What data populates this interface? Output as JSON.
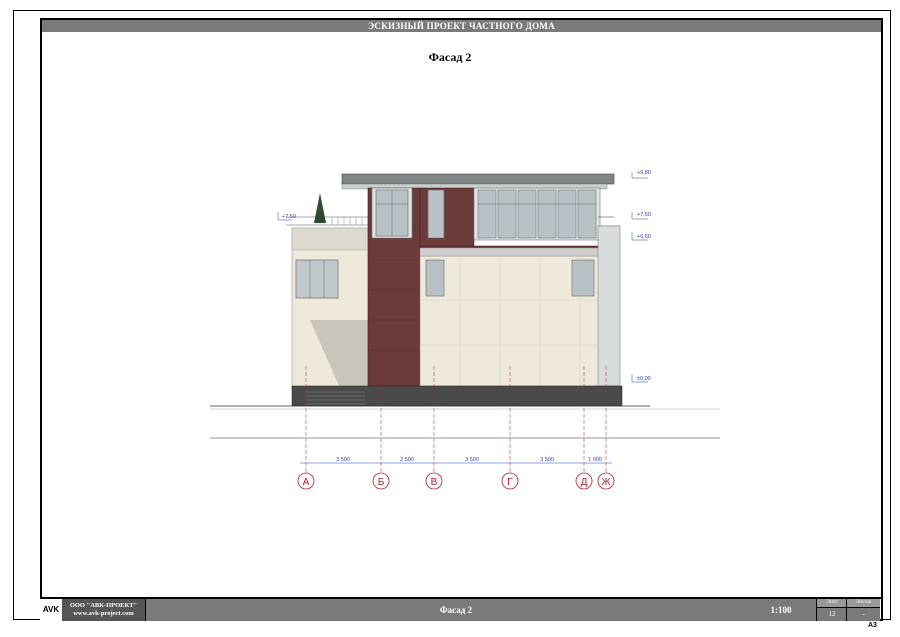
{
  "header": {
    "project_title": "ЭСКИЗНЫЙ ПРОЕКТ ЧАСТНОГО ДОМА",
    "sheet_title": "Фасад 2"
  },
  "elevation_marks": [
    {
      "label": "+9,80"
    },
    {
      "label": "+7,50"
    },
    {
      "label": "+7,50"
    },
    {
      "label": "+6,60"
    },
    {
      "label": "±0,00"
    }
  ],
  "dimensions": [
    "3 500",
    "2 500",
    "3 500",
    "3 500",
    "1 000"
  ],
  "axes": [
    "А",
    "Б",
    "В",
    "Г",
    "Д",
    "Ж"
  ],
  "title_block": {
    "logo": "AVK",
    "company_line1": "ООО \"АВК-ПРОЕКТ\"",
    "company_line2": "www.avk-project.com",
    "sheet_name": "Фасад 2",
    "scale": "1:100",
    "sheet_label": "Лист",
    "sheet_number": "12",
    "sheets_label": "Листов",
    "sheets_total": "-",
    "format": "А3"
  }
}
